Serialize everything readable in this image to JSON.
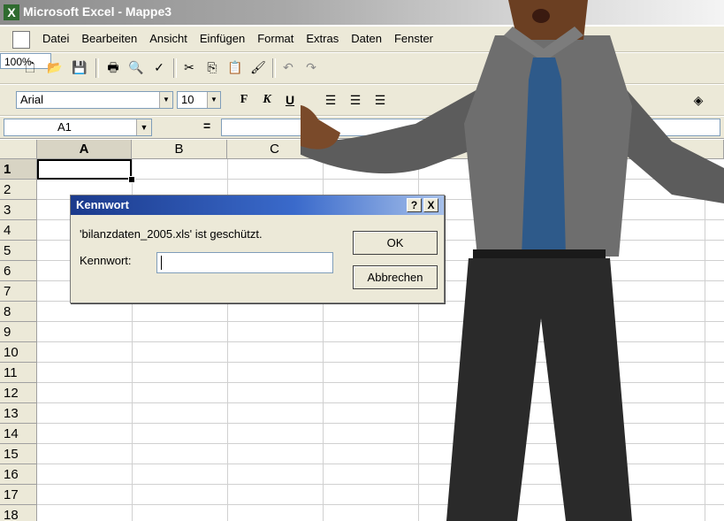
{
  "window": {
    "title": "Microsoft Excel - Mappe3"
  },
  "menu": [
    "Datei",
    "Bearbeiten",
    "Ansicht",
    "Einfügen",
    "Format",
    "Extras",
    "Daten",
    "Fenster"
  ],
  "toolbar": {
    "zoom": "100%"
  },
  "format_toolbar": {
    "font": "Arial",
    "size": "10",
    "bold": "F",
    "italic": "K",
    "underline": "U"
  },
  "formula_bar": {
    "name_box": "A1",
    "equals": "="
  },
  "columns": [
    "A",
    "B",
    "C"
  ],
  "rows": [
    "1",
    "2",
    "3",
    "4",
    "5",
    "6",
    "7",
    "8",
    "9",
    "10",
    "11",
    "12",
    "13",
    "14",
    "15",
    "16",
    "17",
    "18"
  ],
  "dialog": {
    "title": "Kennwort",
    "help": "?",
    "close": "X",
    "message": "'bilanzdaten_2005.xls' ist geschützt.",
    "label": "Kennwort:",
    "ok": "OK",
    "cancel": "Abbrechen"
  }
}
